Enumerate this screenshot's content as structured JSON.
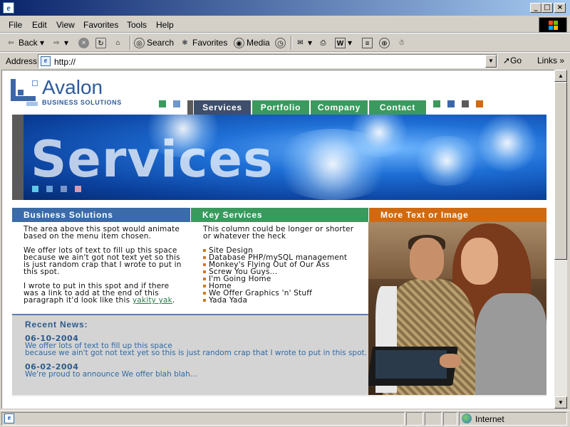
{
  "window": {
    "title": "",
    "buttons": {
      "minimize": "_",
      "maximize": "□",
      "close": "×"
    }
  },
  "menubar": {
    "items": [
      "File",
      "Edit",
      "View",
      "Favorites",
      "Tools",
      "Help"
    ]
  },
  "toolbar": {
    "back": "Back",
    "forward": "",
    "stop": "",
    "refresh": "",
    "home": "",
    "search": "Search",
    "favorites": "Favorites",
    "media": "Media"
  },
  "address": {
    "label": "Address",
    "url": "http://",
    "go": "Go",
    "links": "Links"
  },
  "status": {
    "zone": "Internet"
  },
  "page": {
    "logo": {
      "name": "Avalon",
      "tagline": "BUSINESS SOLUTIONS"
    },
    "nav": {
      "tabs": [
        {
          "label": "Services",
          "color": "#3d4f6b"
        },
        {
          "label": "Portfolio",
          "color": "#3a9a5e"
        },
        {
          "label": "Company",
          "color": "#3a9a5e"
        },
        {
          "label": "Contact",
          "color": "#3a9a5e"
        }
      ]
    },
    "deco_colors": {
      "green": "#3a9a5e",
      "blue": "#3b67a8",
      "gray": "#5a5a5a",
      "orange": "#d06a10",
      "lightblue": "#7aa6d6"
    },
    "banner": {
      "title": "Services"
    },
    "col1": {
      "header": "Business Solutions",
      "header_color": "#3b6ba8",
      "p1": "The area above this spot would animate based on the menu item chosen.",
      "p2": "We offer lots of text to fill up this space because we ain't got not text yet so this is just random crap that I wrote to put in this spot.",
      "p3_pre": "I wrote to put in this spot and if there was a link to add at the end of this paragraph it'd look like this ",
      "p3_link": "yakity yak",
      "p3_post": "."
    },
    "col2": {
      "header": "Key Services",
      "header_color": "#3a9a5e",
      "intro": "This column could be longer or shorter or whatever the heck",
      "items": [
        "Site Design",
        "Database PHP/mySQL management",
        "Monkey's Flying Out of Our Ass",
        "Screw You Guys...",
        "I'm Going Home",
        "Home",
        "We Offer Graphics 'n' Stuff",
        "Yada Yada"
      ]
    },
    "col3": {
      "header": "More Text or Image",
      "header_color": "#d06a10"
    },
    "news": {
      "title": "Recent News:",
      "entries": [
        {
          "date": "06-10-2004",
          "line1": "We offer lots of text to fill up this space",
          "line2": "because we ain't got not text yet so this is just random crap that I wrote to put in this spot."
        },
        {
          "date": "06-02-2004",
          "line1": "We're proud to announce We offer blah blah..."
        }
      ]
    }
  }
}
